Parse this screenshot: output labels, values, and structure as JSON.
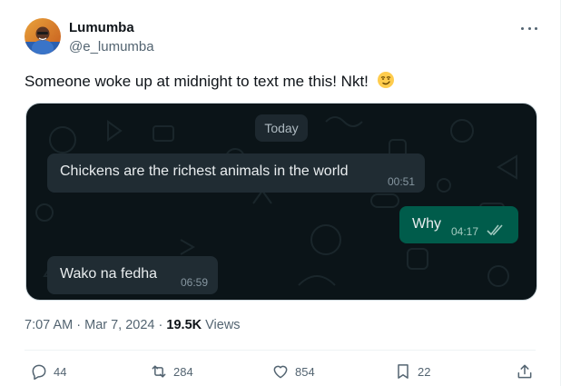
{
  "author": {
    "display_name": "Lumumba",
    "handle": "@e_lumumba"
  },
  "tweet": {
    "text": "Someone woke up at midnight to text me this! Nkt!",
    "emoji": "smirking-face"
  },
  "chat": {
    "day_label": "Today",
    "messages": [
      {
        "direction": "incoming",
        "text": "Chickens are the richest animals in the world",
        "time": "00:51"
      },
      {
        "direction": "outgoing",
        "text": "Why",
        "time": "04:17",
        "status": "read"
      },
      {
        "direction": "incoming",
        "text": "Wako na fedha",
        "time": "06:59"
      }
    ]
  },
  "meta": {
    "time": "7:07 AM",
    "separator": "·",
    "date": "Mar 7, 2024",
    "views_count": "19.5K",
    "views_label": "Views"
  },
  "actions": {
    "replies": "44",
    "reposts": "284",
    "likes": "854",
    "bookmarks": "22"
  },
  "colors": {
    "text": "#0f1419",
    "secondary": "#536471",
    "chat_bg": "#0b1418",
    "incoming_bubble": "#202c33",
    "outgoing_bubble": "#005c4b",
    "read_ticks": "#a3cbc1"
  }
}
